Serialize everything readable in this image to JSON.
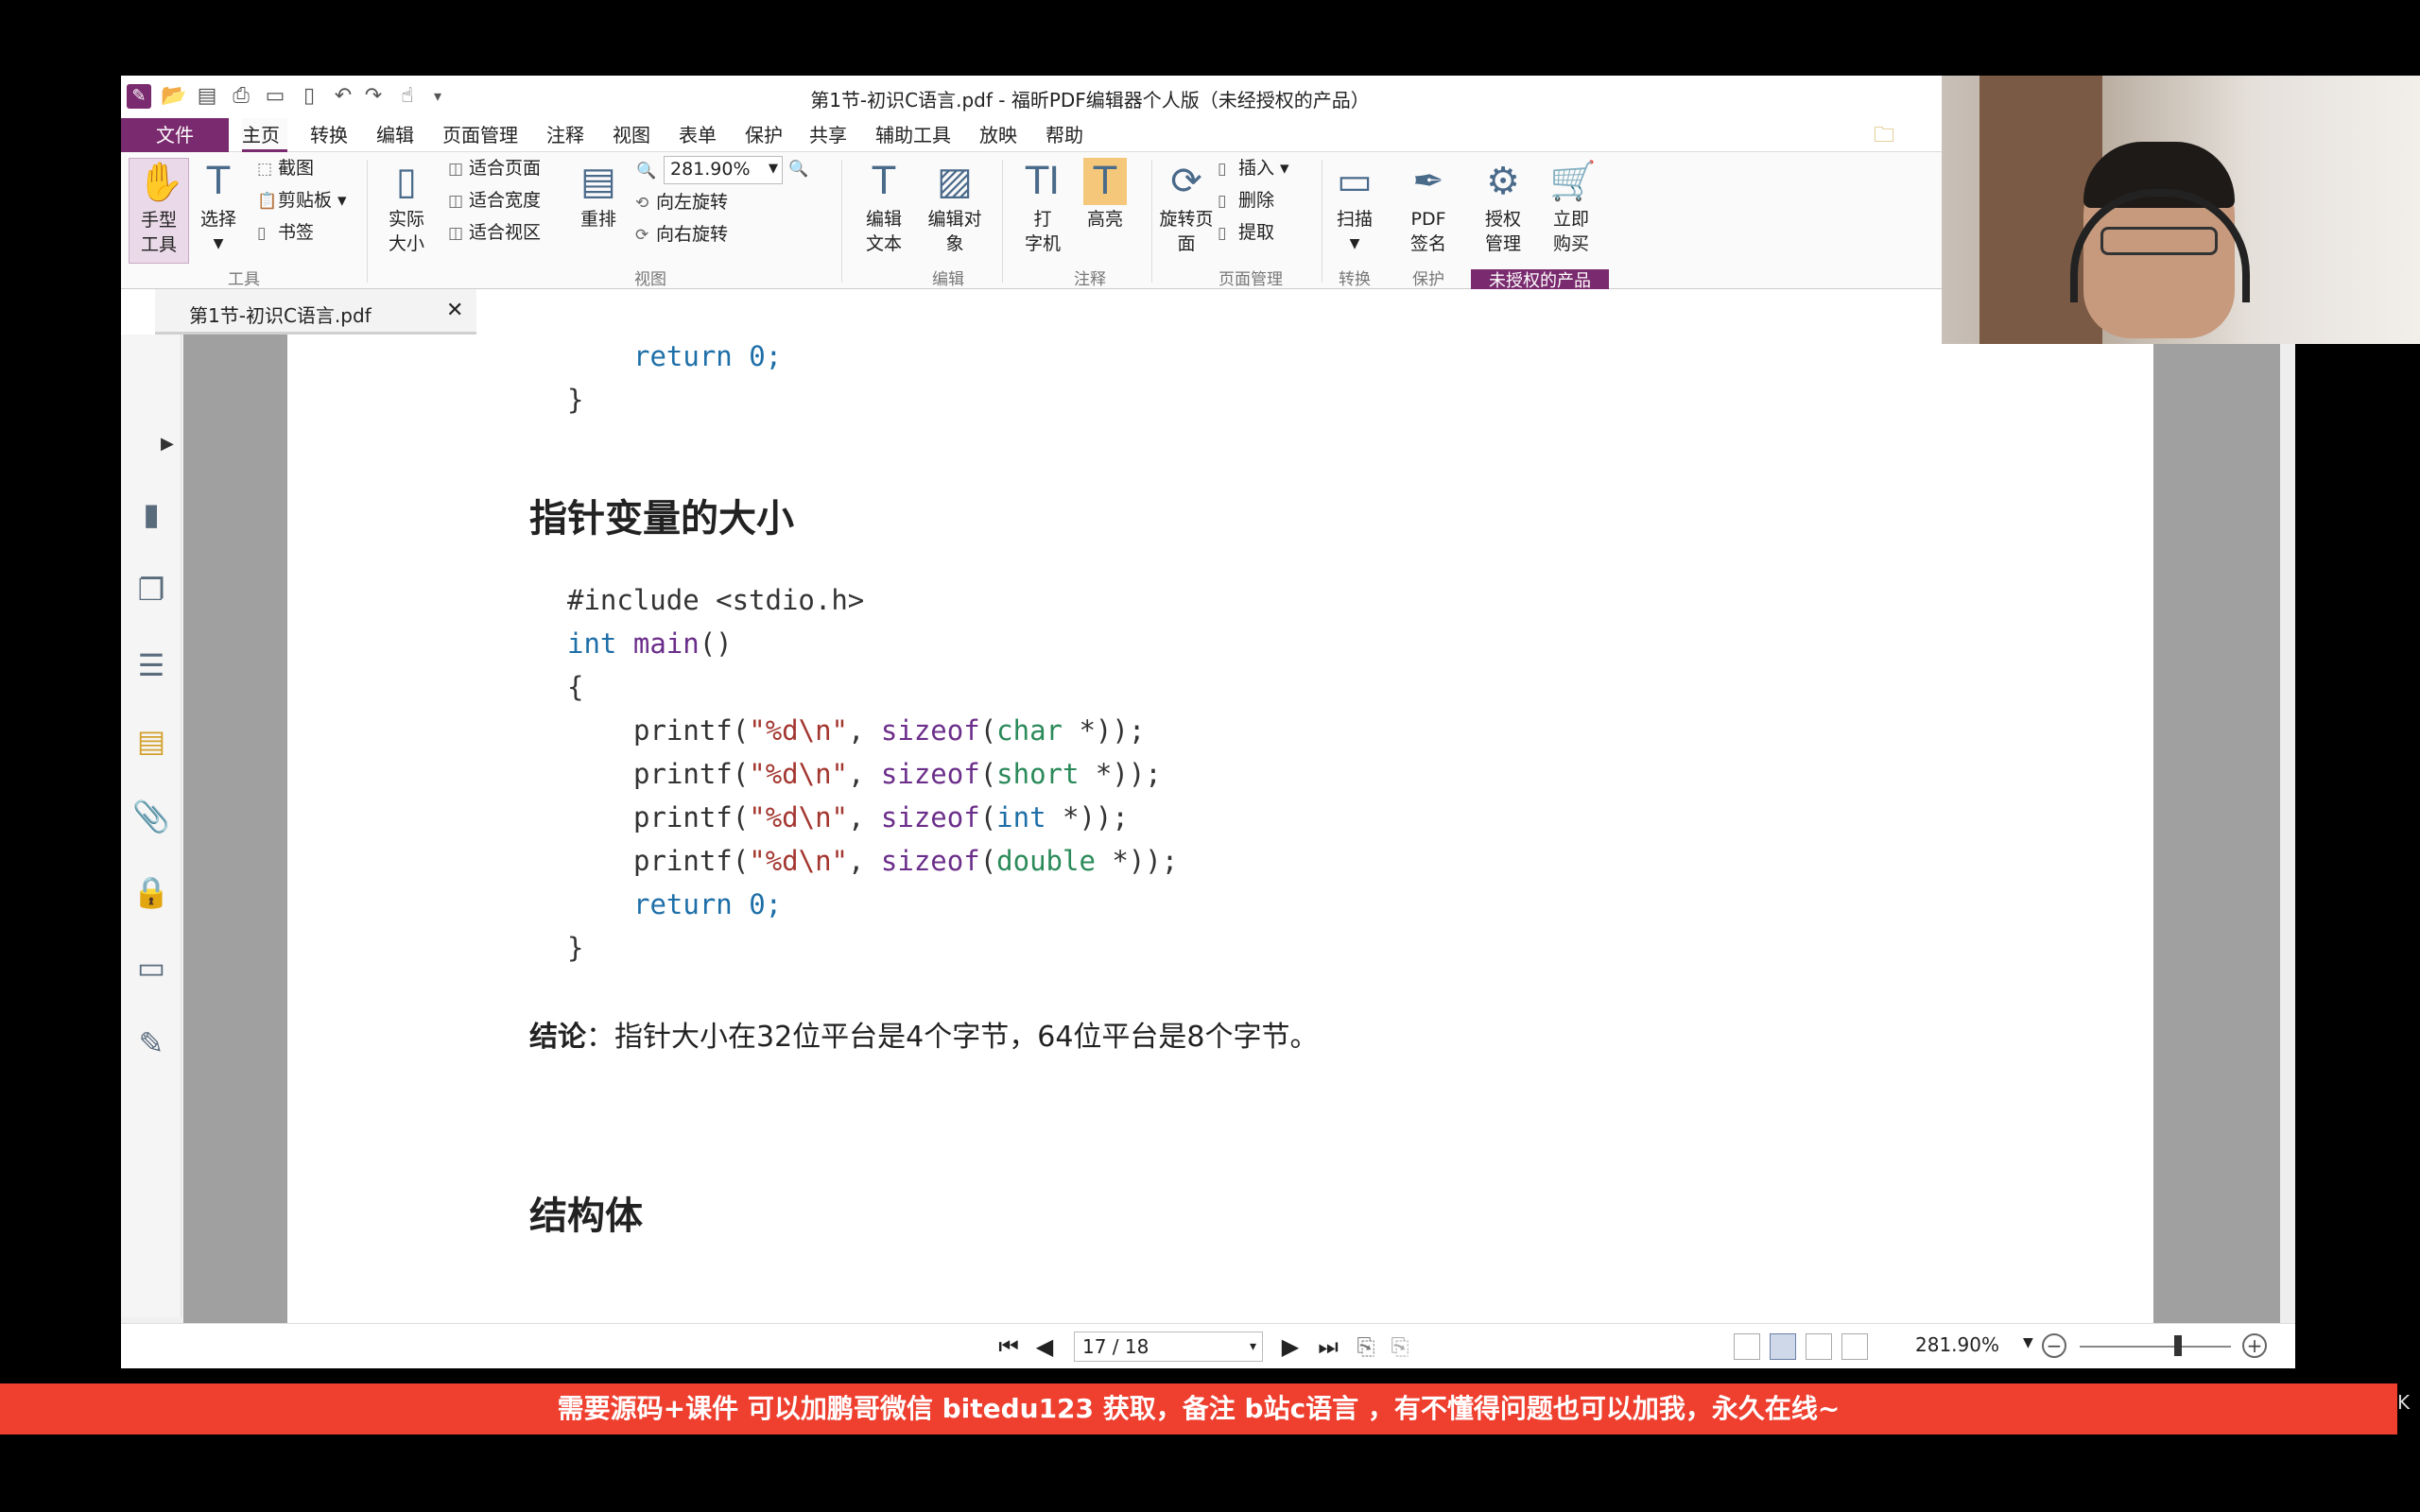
{
  "window": {
    "title": "第1节-初识C语言.pdf - 福昕PDF编辑器个人版（未经授权的产品）"
  },
  "quick_access": {
    "icons": [
      "app-logo-icon",
      "open-icon",
      "save-icon",
      "print-icon",
      "scan-icon",
      "new-icon",
      "undo-icon",
      "redo-icon",
      "hand-icon",
      "customize-icon"
    ]
  },
  "menu": {
    "file": "文件",
    "items": [
      "主页",
      "转换",
      "编辑",
      "页面管理",
      "注释",
      "视图",
      "表单",
      "保护",
      "共享",
      "辅助工具",
      "放映",
      "帮助"
    ],
    "active": "主页"
  },
  "ribbon": {
    "hand_tool": "手型\n工具",
    "select": "选择",
    "screenshot": "截图",
    "clipboard": "剪贴板",
    "bookmark": "书签",
    "actual_size": "实际\n大小",
    "fit_page": "适合页面",
    "fit_width": "适合宽度",
    "fit_visible": "适合视区",
    "reflow": "重排",
    "zoom_value": "281.90%",
    "rotate_left": "向左旋转",
    "rotate_right": "向右旋转",
    "edit_text": "编辑\n文本",
    "edit_object": "编辑对\n象",
    "typewriter": "打\n字机",
    "highlight": "高亮",
    "rotate_page": "旋转页\n面",
    "insert": "插入",
    "delete": "删除",
    "extract": "提取",
    "scan": "扫描",
    "pdf_sign": "PDF\n签名",
    "license_mgmt": "授权\n管理",
    "buy_now": "立即\n购买",
    "groups": {
      "tools": "工具",
      "view": "视图",
      "edit": "编辑",
      "comment": "注释",
      "page_mgmt": "页面管理",
      "convert": "转换",
      "protect": "保护"
    },
    "unlicensed": "未授权的产品"
  },
  "tab": {
    "label": "第1节-初识C语言.pdf",
    "close": "✕"
  },
  "doc": {
    "code1_return": "return 0;",
    "code1_brace": "}",
    "heading1": "指针变量的大小",
    "code2": {
      "include": "#include <stdio.h>",
      "int_kw": "int",
      "main_fn": "main",
      "main_paren": "()",
      "open_brace": "{",
      "lines": [
        {
          "fn": "printf",
          "str": "\"%d\\n\"",
          "type": "char"
        },
        {
          "fn": "printf",
          "str": "\"%d\\n\"",
          "type": "short"
        },
        {
          "fn": "printf",
          "str": "\"%d\\n\"",
          "type": "int"
        },
        {
          "fn": "printf",
          "str": "\"%d\\n\"",
          "type": "double"
        }
      ],
      "sizeof_kw": "sizeof",
      "return_line": "return 0;",
      "close_brace": "}"
    },
    "conclusion_label": "结论",
    "conclusion_text": "：指针大小在32位平台是4个字节，64位平台是8个字节。",
    "heading2": "结构体"
  },
  "status": {
    "page_value": "17 / 18",
    "zoom": "281.90%"
  },
  "banner": {
    "text": "需要源码+课件 可以加鹏哥微信 bitedu123 获取，备注 b站c语言 ，有不懂得问题也可以加我，永久在线~"
  },
  "overlay": {
    "edge_letter": "K"
  },
  "colors": {
    "brand": "#7a2a6e",
    "banner": "#ee3f2f",
    "keyword": "#1e6fa8",
    "string": "#a3362f",
    "type": "#2b8a5a"
  }
}
